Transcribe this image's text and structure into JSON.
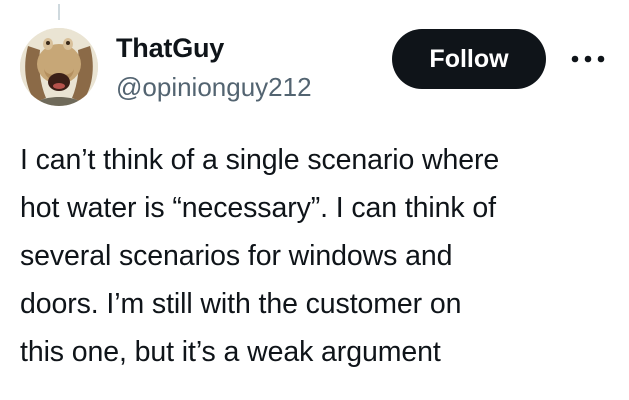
{
  "author": {
    "display_name": "ThatGuy",
    "handle": "@opinionguy212",
    "avatar_icon": "gungan-cartoon-avatar"
  },
  "follow_button": {
    "label": "Follow"
  },
  "more_menu": {
    "icon": "more-horizontal-icon"
  },
  "tweet": {
    "lines": [
      "I can’t think of a single scenario where",
      "hot water is “necessary”. I can think of",
      "several scenarios for windows and",
      "doors. I’m still with the customer on",
      "this one, but it’s a weak argument"
    ]
  },
  "colors": {
    "text_primary": "#0f1419",
    "text_secondary": "#536471",
    "button_bg": "#0f1419",
    "button_text": "#ffffff"
  }
}
